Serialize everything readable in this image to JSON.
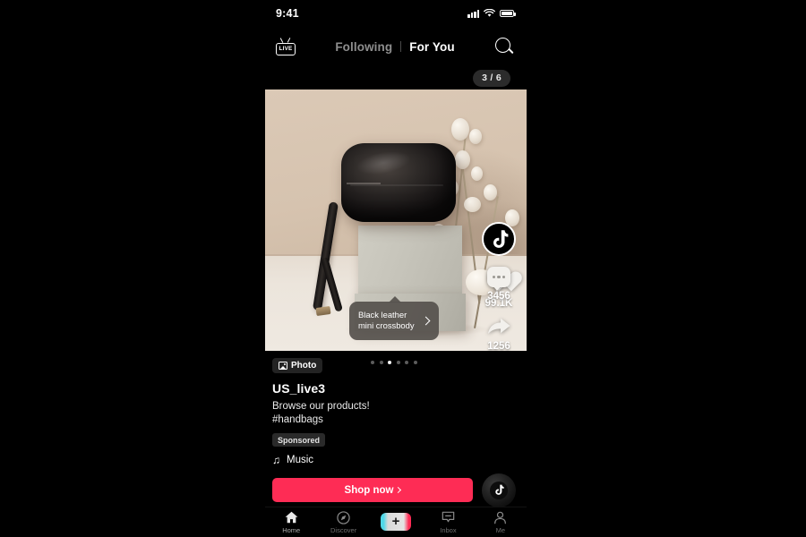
{
  "status_bar": {
    "time": "9:41",
    "icons": [
      "signal-icon",
      "wifi-icon",
      "battery-icon"
    ]
  },
  "top_bar": {
    "live_icon_label": "LIVE",
    "tabs": [
      {
        "label": "Following",
        "active": false
      },
      {
        "label": "For You",
        "active": true
      }
    ],
    "search_icon": "search-icon"
  },
  "counter_badge": {
    "text": "3 / 6",
    "current": 3,
    "total": 6
  },
  "media": {
    "product_tag": {
      "line1": "Black leather",
      "line2": "mini crossbody",
      "chevron": "chevron-right-icon"
    },
    "carousel": {
      "total": 6,
      "current": 3
    }
  },
  "actions": {
    "avatar_icon": "tiktok-logo-icon",
    "like": {
      "icon": "heart-icon",
      "count": "99.1K"
    },
    "comment": {
      "icon": "comment-bubble-icon",
      "count": "3456"
    },
    "share": {
      "icon": "share-arrow-icon",
      "count": "1256"
    }
  },
  "post": {
    "type_badge": {
      "label": "Photo",
      "icon": "image-icon"
    },
    "username": "US_live3",
    "caption_line1": "Browse our products!",
    "caption_line2": "#handbags",
    "sponsored_label": "Sponsored",
    "music": {
      "icon": "music-note-icon",
      "label": "Music",
      "glyph": "♫"
    },
    "cta": {
      "label": "Shop now",
      "chevron": "chevron-right-icon",
      "color": "#fe2c55"
    },
    "disc_icon": "tiktok-music-disc-icon"
  },
  "bottom_nav": {
    "items": [
      {
        "label": "Home",
        "icon": "home-icon",
        "active": true
      },
      {
        "label": "Discover",
        "icon": "compass-icon",
        "active": false
      },
      {
        "label": "",
        "icon": "create-plus-icon",
        "active": false
      },
      {
        "label": "Inbox",
        "icon": "inbox-icon",
        "active": false
      },
      {
        "label": "Me",
        "icon": "person-icon",
        "active": false
      }
    ]
  },
  "colors": {
    "accent_pink": "#fe2c55",
    "accent_cyan": "#4fd8e8",
    "background": "#000000"
  }
}
